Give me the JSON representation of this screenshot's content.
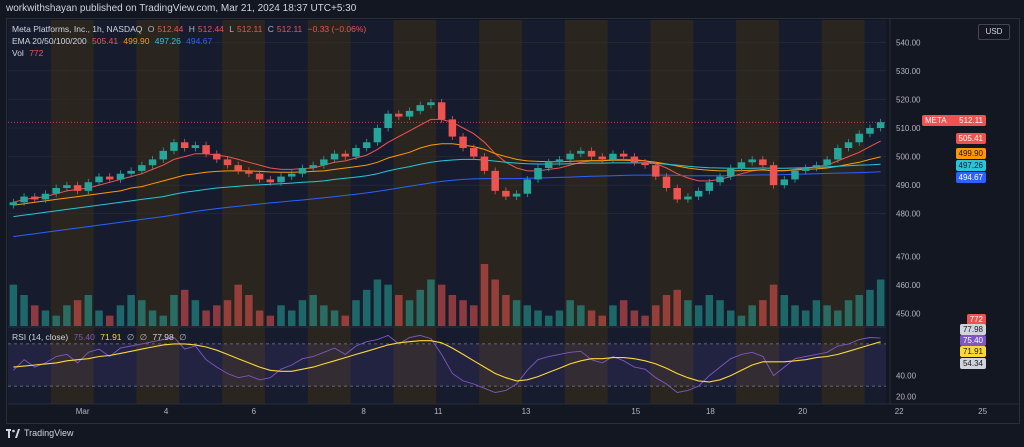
{
  "header": {
    "published_text": "workwithshayan published on TradingView.com, Mar 21, 2024 18:37 UTC+5:30"
  },
  "legend": {
    "symbol": "Meta Platforms, Inc., 1h, NASDAQ",
    "o_label": "O",
    "o_value": "512.44",
    "h_label": "H",
    "h_value": "512.44",
    "l_label": "L",
    "l_value": "512.11",
    "c_label": "C",
    "c_value": "512.11",
    "change": "−0.33 (−0.06%)",
    "ema_label": "EMA 20/50/100/200",
    "ema20": "505.41",
    "ema50": "499.90",
    "ema100": "497.26",
    "ema200": "494.67",
    "vol_label": "Vol",
    "vol_value": "772",
    "rsi_label": "RSI (14, close)",
    "rsi_value": "75.40",
    "rsi_ma": "71.91",
    "rsi_na1": "∅",
    "rsi_na2": "∅",
    "rsi_upper": "77.98",
    "rsi_na3": "∅"
  },
  "currency_button": "USD",
  "footer_brand": "TradingView",
  "price_tags": {
    "meta_label": "META",
    "meta_price": "512.11",
    "ema20": "505.41",
    "ema50": "499.90",
    "ema100": "497.26",
    "ema200": "494.67",
    "vol": "772"
  },
  "rsi_tags": {
    "upper": "77.98",
    "rsi": "75.40",
    "ma": "71.91",
    "lower": "54.34"
  },
  "colors": {
    "bg": "#131722",
    "up": "#26a69a",
    "down": "#ef5350",
    "ema20": "#ef5350",
    "ema50": "#ff9800",
    "ema100": "#26c6da",
    "ema200": "#2962ff",
    "rsi": "#7e57c2",
    "rsi_ma": "#fdd835",
    "session_extended": "#b8860b",
    "session_regular": "#2a3f7a"
  },
  "chart_data": [
    {
      "type": "candlestick",
      "title": "Meta Platforms, Inc., 1h, NASDAQ",
      "ylim": [
        475,
        545
      ],
      "yticks": [
        480,
        490,
        500,
        510,
        520,
        530,
        540
      ],
      "xticks": [
        "Mar",
        "4",
        "6",
        "8",
        "11",
        "13",
        "15",
        "18",
        "20",
        "22",
        "25"
      ],
      "grid": true,
      "close_series": [
        484,
        486,
        485,
        487,
        489,
        490,
        488,
        491,
        493,
        492,
        494,
        495,
        497,
        499,
        502,
        505,
        503,
        504,
        501,
        499,
        497,
        495,
        494,
        492,
        491,
        493,
        494,
        496,
        497,
        499,
        501,
        500,
        503,
        505,
        510,
        515,
        514,
        516,
        518,
        519,
        513,
        507,
        503,
        500,
        495,
        488,
        486,
        487,
        492,
        496,
        498,
        499,
        501,
        502,
        500,
        499,
        501,
        500,
        498,
        497,
        493,
        489,
        485,
        486,
        488,
        491,
        493,
        496,
        498,
        499,
        497,
        490,
        492,
        495,
        496,
        497,
        499,
        503,
        505,
        508,
        510,
        512
      ],
      "ema_series": [
        {
          "name": "EMA 20",
          "values": [
            484,
            485,
            485.5,
            486,
            487,
            488,
            488.5,
            489,
            490,
            491,
            492,
            493,
            494,
            495.5,
            497,
            499,
            500,
            501,
            501,
            500.5,
            500,
            499,
            498,
            497,
            496,
            495.5,
            495.5,
            495.8,
            496,
            497,
            498,
            498.5,
            499.5,
            500.5,
            502.5,
            505,
            507,
            509,
            511,
            513,
            513,
            512,
            510,
            508,
            505,
            501,
            498,
            496,
            495,
            495,
            495.5,
            496,
            497,
            498,
            498.5,
            498.5,
            499,
            499,
            499,
            498.5,
            497.5,
            496,
            494,
            492.5,
            491.5,
            491.5,
            492,
            493,
            494,
            495,
            495.5,
            495,
            495,
            495.5,
            496,
            496.5,
            497,
            498.5,
            500,
            501.5,
            503.5,
            505.4
          ]
        },
        {
          "name": "EMA 50",
          "values": [
            483,
            483.5,
            484,
            484.5,
            485,
            485.5,
            486,
            486.5,
            487,
            487.5,
            488,
            489,
            489.5,
            490.5,
            491.5,
            492.5,
            493.5,
            494,
            494.5,
            494.8,
            495,
            495,
            495,
            494.8,
            494.6,
            494.5,
            494.5,
            494.6,
            494.8,
            495,
            495.5,
            496,
            496.5,
            497,
            498,
            499.5,
            500.5,
            501.5,
            503,
            504,
            504.5,
            504.5,
            504,
            503.5,
            502.5,
            501,
            500,
            499,
            498.5,
            498.3,
            498.2,
            498.2,
            498.3,
            498.5,
            498.6,
            498.6,
            498.7,
            498.7,
            498.6,
            498.5,
            498,
            497.4,
            496.7,
            496,
            495.5,
            495.2,
            495,
            495,
            495.1,
            495.2,
            495.3,
            495.1,
            495.1,
            495.3,
            495.5,
            495.7,
            496,
            496.6,
            497.3,
            498,
            499,
            499.9
          ]
        },
        {
          "name": "EMA 100",
          "values": [
            479,
            479.5,
            480,
            480.5,
            481,
            481.5,
            482,
            482.5,
            483,
            483.5,
            484,
            484.5,
            485,
            485.5,
            486,
            486.8,
            487.5,
            488,
            488.5,
            489,
            489.3,
            489.6,
            489.9,
            490.1,
            490.3,
            490.5,
            490.7,
            491,
            491.2,
            491.5,
            492,
            492.4,
            492.8,
            493.3,
            494,
            495,
            495.8,
            496.5,
            497.3,
            498,
            498.5,
            498.8,
            499,
            499,
            498.8,
            498.4,
            498,
            497.7,
            497.5,
            497.4,
            497.4,
            497.4,
            497.5,
            497.6,
            497.7,
            497.7,
            497.8,
            497.8,
            497.8,
            497.8,
            497.6,
            497.3,
            497,
            496.6,
            496.3,
            496.1,
            496,
            495.9,
            495.9,
            495.9,
            496,
            495.9,
            495.9,
            496,
            496.1,
            496.2,
            496.4,
            496.6,
            496.8,
            497,
            497.1,
            497.3
          ]
        },
        {
          "name": "EMA 200",
          "values": [
            472,
            472.5,
            473,
            473.5,
            474,
            474.5,
            475,
            475.5,
            476,
            476.5,
            477,
            477.5,
            478,
            478.5,
            479,
            479.6,
            480.2,
            480.8,
            481.3,
            481.8,
            482.2,
            482.6,
            483,
            483.4,
            483.8,
            484.1,
            484.5,
            484.8,
            485.2,
            485.6,
            486,
            486.4,
            486.8,
            487.3,
            487.8,
            488.4,
            489,
            489.6,
            490.2,
            490.8,
            491.3,
            491.7,
            492,
            492.2,
            492.3,
            492.3,
            492.3,
            492.3,
            492.4,
            492.5,
            492.6,
            492.7,
            492.8,
            493,
            493.1,
            493.2,
            493.3,
            493.4,
            493.5,
            493.5,
            493.5,
            493.5,
            493.4,
            493.3,
            493.3,
            493.3,
            493.3,
            493.3,
            493.4,
            493.5,
            493.6,
            493.6,
            493.7,
            493.8,
            493.9,
            494,
            494.1,
            494.2,
            494.3,
            494.4,
            494.5,
            494.67
          ]
        }
      ]
    },
    {
      "type": "bar",
      "title": "Vol",
      "values": [
        8,
        6,
        4,
        3,
        2,
        4,
        5,
        6,
        3,
        2,
        4,
        6,
        5,
        3,
        2,
        6,
        7,
        5,
        3,
        4,
        5,
        8,
        6,
        3,
        2,
        4,
        3,
        5,
        6,
        4,
        3,
        2,
        5,
        7,
        9,
        8,
        6,
        5,
        7,
        9,
        8,
        6,
        5,
        4,
        12,
        9,
        6,
        5,
        4,
        3,
        2,
        3,
        5,
        4,
        3,
        2,
        4,
        5,
        3,
        2,
        4,
        6,
        7,
        5,
        4,
        6,
        5,
        3,
        2,
        4,
        5,
        8,
        6,
        4,
        3,
        5,
        4,
        3,
        5,
        6,
        7,
        9
      ]
    },
    {
      "type": "line",
      "title": "RSI (14, close)",
      "ylim": [
        15,
        85
      ],
      "yticks": [
        20,
        40
      ],
      "bands": [
        30,
        70
      ],
      "series": [
        {
          "name": "RSI",
          "values": [
            45,
            55,
            48,
            52,
            58,
            60,
            52,
            62,
            65,
            58,
            66,
            68,
            70,
            72,
            74,
            76,
            65,
            68,
            55,
            48,
            42,
            38,
            40,
            36,
            38,
            46,
            50,
            56,
            58,
            62,
            66,
            60,
            68,
            72,
            74,
            78,
            70,
            76,
            78,
            75,
            60,
            42,
            35,
            32,
            28,
            24,
            26,
            32,
            45,
            55,
            58,
            60,
            62,
            63,
            55,
            52,
            58,
            54,
            48,
            46,
            38,
            32,
            24,
            26,
            30,
            40,
            48,
            56,
            60,
            62,
            58,
            40,
            48,
            56,
            58,
            60,
            62,
            68,
            70,
            74,
            76,
            75.4
          ]
        },
        {
          "name": "RSI MA",
          "values": [
            48,
            49,
            50,
            51,
            52,
            54,
            55,
            56,
            58,
            59,
            61,
            63,
            65,
            67,
            69,
            70,
            70,
            69,
            67,
            64,
            60,
            56,
            52,
            48,
            45,
            44,
            44,
            46,
            48,
            51,
            54,
            57,
            60,
            63,
            66,
            69,
            71,
            72,
            73,
            73,
            71,
            66,
            60,
            54,
            48,
            42,
            38,
            35,
            36,
            39,
            43,
            47,
            51,
            54,
            56,
            56,
            57,
            57,
            56,
            54,
            51,
            47,
            42,
            38,
            35,
            34,
            36,
            40,
            45,
            50,
            53,
            53,
            53,
            54,
            55,
            57,
            58,
            60,
            63,
            66,
            69,
            71.91
          ]
        }
      ]
    }
  ]
}
